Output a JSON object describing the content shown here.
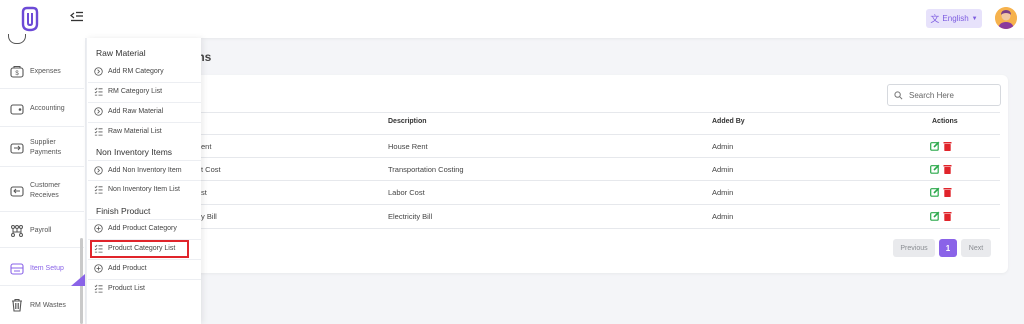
{
  "header": {
    "language_label": "English"
  },
  "sidebar": {
    "items": [
      {
        "label": "Expenses"
      },
      {
        "label": "Accounting"
      },
      {
        "label": "Supplier Payments"
      },
      {
        "label": "Customer Receives"
      },
      {
        "label": "Payroll"
      },
      {
        "label": "Item Setup"
      },
      {
        "label": "RM Wastes"
      }
    ]
  },
  "flyout": {
    "sections": [
      {
        "heading": "Raw Material",
        "items": [
          "Add RM Category",
          "RM Category List",
          "Add Raw Material",
          "Raw Material List"
        ]
      },
      {
        "heading": "Non Inventory Items",
        "items": [
          "Add Non Inventory Item",
          "Non Inventory Item List"
        ]
      },
      {
        "heading": "Finish Product",
        "items": [
          "Add Product Category",
          "Product Category List",
          "Add Product",
          "Product List"
        ]
      }
    ]
  },
  "main": {
    "title_partial": "ms",
    "search_placeholder": "Search Here",
    "table": {
      "headers": [
        "Description",
        "Added By",
        "Actions"
      ],
      "rows": [
        {
          "name_partial": "ent",
          "description": "House Rent",
          "added_by": "Admin"
        },
        {
          "name_partial": "t Cost",
          "description": "Transportation Costing",
          "added_by": "Admin"
        },
        {
          "name_partial": "st",
          "description": "Labor Cost",
          "added_by": "Admin"
        },
        {
          "name_partial": "y Bill",
          "description": "Electricity Bill",
          "added_by": "Admin"
        }
      ]
    },
    "pagination": {
      "previous": "Previous",
      "current": "1",
      "next": "Next"
    }
  },
  "colors": {
    "accent": "#8a63e8",
    "edit": "#2aa84a",
    "delete": "#e0242b",
    "highlight": "#e0242b"
  }
}
